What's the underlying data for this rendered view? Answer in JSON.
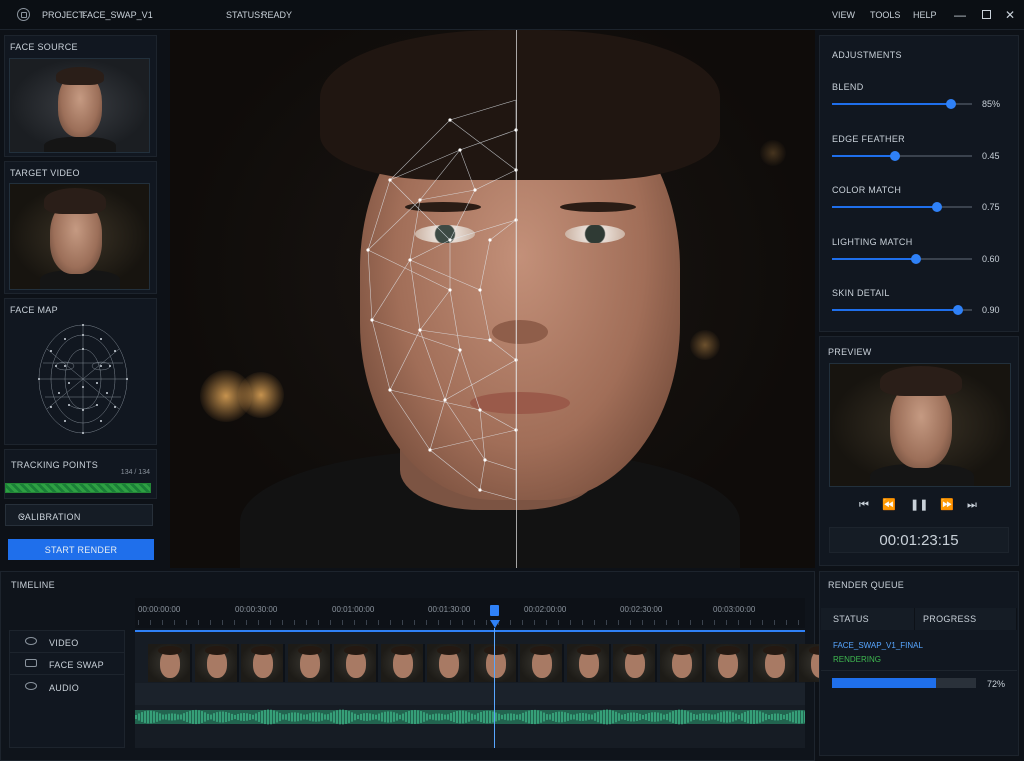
{
  "app": {
    "project_label": "PROJECT:",
    "project_name": "FACE_SWAP_V1",
    "status_label": "STATUS:",
    "status_value": "READY",
    "menu": [
      "VIEW",
      "TOOLS",
      "HELP"
    ],
    "window_controls": [
      "minimize-icon",
      "maximize-icon",
      "close-icon"
    ]
  },
  "left": {
    "face_source": "FACE SOURCE",
    "target_video": "TARGET VIDEO",
    "face_map": "FACE MAP",
    "tracking_points": "TRACKING POINTS",
    "tracking_count": "134 / 134",
    "tracking_progress": 1.0,
    "calibration": "CALIBRATION",
    "start_render": "START RENDER"
  },
  "adjustments": {
    "title": "ADJUSTMENTS",
    "sliders": [
      {
        "label": "BLEND",
        "value": 0.85,
        "display": "85%"
      },
      {
        "label": "EDGE FEATHER",
        "value": 0.45,
        "display": "0.45"
      },
      {
        "label": "COLOR MATCH",
        "value": 0.75,
        "display": "0.75"
      },
      {
        "label": "LIGHTING MATCH",
        "value": 0.6,
        "display": "0.60"
      },
      {
        "label": "SKIN DETAIL",
        "value": 0.9,
        "display": "0.90"
      }
    ]
  },
  "preview": {
    "title": "PREVIEW",
    "timecode": "00:01:23:15",
    "transport": [
      "skip-back-icon",
      "rewind-icon",
      "pause-icon",
      "fast-forward-icon",
      "skip-forward-icon"
    ]
  },
  "timeline": {
    "title": "TIMELINE",
    "ruler": [
      "00:00:00:00",
      "00:00:30:00",
      "00:01:00:00",
      "00:01:30:00",
      "00:02:00:00",
      "00:02:30:00",
      "00:03:00:00"
    ],
    "tracks": [
      "VIDEO",
      "FACE SWAP",
      "AUDIO"
    ]
  },
  "render_queue": {
    "title": "RENDER QUEUE",
    "columns": [
      "STATUS",
      "PROGRESS"
    ],
    "job_name": "FACE_SWAP_V1_FINAL",
    "job_status": "RENDERING",
    "progress": 0.72,
    "progress_label": "72%"
  },
  "colors": {
    "accent": "#1f6feb",
    "ready": "#3fb950",
    "rendering": "#3fb950",
    "job_name": "#58a6ff"
  }
}
